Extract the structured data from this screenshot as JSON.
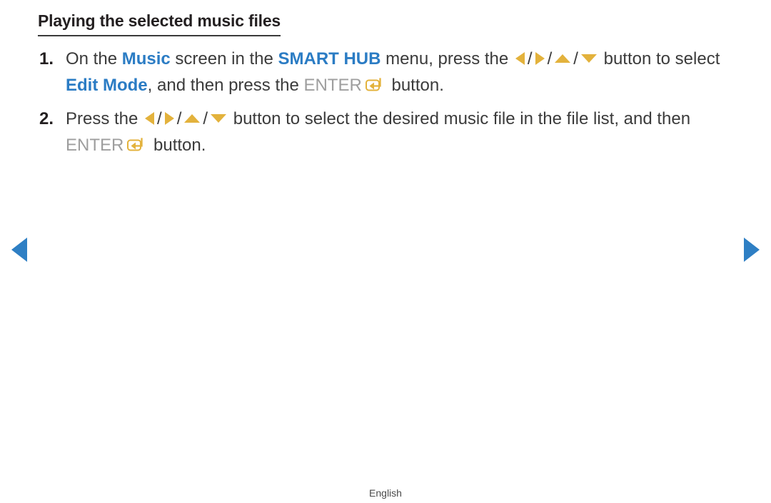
{
  "page": {
    "title": "Playing the selected music files",
    "footer_language": "English"
  },
  "colors": {
    "keyword_blue": "#2b7cc4",
    "nav_arrow_blue": "#2e7fc4",
    "direction_arrow_gold": "#e3b23c",
    "enter_label_gray": "#9e9e9e",
    "body_text": "#3b3b3b"
  },
  "steps": [
    {
      "number": "1.",
      "segments": [
        {
          "type": "text",
          "value": "On the "
        },
        {
          "type": "keyword",
          "value": "Music"
        },
        {
          "type": "text",
          "value": " screen in the "
        },
        {
          "type": "keyword",
          "value": "SMART HUB"
        },
        {
          "type": "text",
          "value": " menu, press the "
        },
        {
          "type": "icon",
          "value": "arrow-left-icon"
        },
        {
          "type": "sep",
          "value": "/"
        },
        {
          "type": "icon",
          "value": "arrow-right-icon"
        },
        {
          "type": "sep",
          "value": "/"
        },
        {
          "type": "icon",
          "value": "arrow-up-icon"
        },
        {
          "type": "sep",
          "value": "/"
        },
        {
          "type": "icon",
          "value": "arrow-down-icon"
        },
        {
          "type": "text",
          "value": " button to select "
        },
        {
          "type": "keyword",
          "value": "Edit Mode"
        },
        {
          "type": "text",
          "value": ", and then press the "
        },
        {
          "type": "enter-label",
          "value": "ENTER"
        },
        {
          "type": "icon",
          "value": "enter-key-icon"
        },
        {
          "type": "text",
          "value": " button."
        }
      ]
    },
    {
      "number": "2.",
      "segments": [
        {
          "type": "text",
          "value": "Press the "
        },
        {
          "type": "icon",
          "value": "arrow-left-icon"
        },
        {
          "type": "sep",
          "value": "/"
        },
        {
          "type": "icon",
          "value": "arrow-right-icon"
        },
        {
          "type": "sep",
          "value": "/"
        },
        {
          "type": "icon",
          "value": "arrow-up-icon"
        },
        {
          "type": "sep",
          "value": "/"
        },
        {
          "type": "icon",
          "value": "arrow-down-icon"
        },
        {
          "type": "text",
          "value": " button to select the desired music file in the file list, and then "
        },
        {
          "type": "enter-label",
          "value": "ENTER"
        },
        {
          "type": "icon",
          "value": "enter-key-icon"
        },
        {
          "type": "text",
          "value": " button."
        }
      ]
    }
  ],
  "step1": {
    "number": "1.",
    "t1": "On the ",
    "kw1": "Music",
    "t2": " screen in the ",
    "kw2": "SMART HUB",
    "t3": " menu, press the ",
    "sep1": "/",
    "sep2": "/",
    "sep3": "/",
    "t4": " button to select ",
    "kw3": "Edit Mode",
    "t5": ", and then press the ",
    "enter_label": "ENTER",
    "t6": " button."
  },
  "step2": {
    "number": "2.",
    "t1": "Press the ",
    "sep1": "/",
    "sep2": "/",
    "sep3": "/",
    "t2": " button to select the desired music file in the file list, and then ",
    "enter_label": "ENTER",
    "t3": " button."
  },
  "navigation": {
    "prev_label": "previous-page",
    "next_label": "next-page"
  }
}
